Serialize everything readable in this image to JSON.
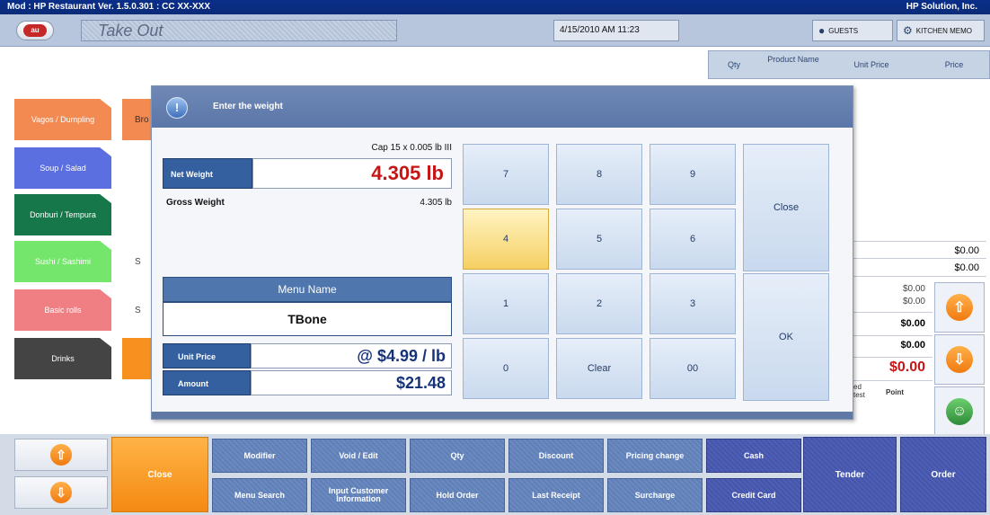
{
  "titlebar": {
    "left": "Mod : HP Restaurant Ver. 1.5.0.301 : CC XX-XXX",
    "right": "HP Solution, Inc."
  },
  "header": {
    "logo": "au",
    "order_type": "Take Out",
    "datetime": "4/15/2010 AM 11:23",
    "guests_label": "GUESTS",
    "kitchen_label": "KITCHEN MEMO"
  },
  "list_header": {
    "qty": "Qty",
    "product": "Product Name",
    "unit_price": "Unit Price",
    "price": "Price"
  },
  "categories": [
    {
      "label": "Vagos / Dumpling",
      "color": "#f28a52",
      "side": "Bro"
    },
    {
      "label": "Soup / Salad",
      "color": "#5b6fe0",
      "side": ""
    },
    {
      "label": "Donburi / Tempura",
      "color": "#16784a",
      "side": ""
    },
    {
      "label": "Sushi / Sashimi",
      "color": "#74e66b",
      "side": "S"
    },
    {
      "label": "Basic rolls",
      "color": "#f07f84",
      "side": "S"
    },
    {
      "label": "Drinks",
      "color": "#444444",
      "side": ""
    }
  ],
  "order_summary": {
    "row1": "$0.00",
    "row2": "$0.00",
    "row3a": "$0.00",
    "row3b": "$0.00",
    "row4": "$0.00",
    "row5": "$0.00",
    "total": "$0.00",
    "label_ed": "ed",
    "label_test": "test",
    "label_point": "Point"
  },
  "dialog": {
    "title": "Enter the weight",
    "cap": "Cap 15 x 0.005 lb III",
    "net_weight_label": "Net Weight",
    "net_weight_value": "4.305 lb",
    "gross_weight_label": "Gross Weight",
    "gross_weight_value": "4.305 lb",
    "menu_name_label": "Menu Name",
    "menu_name_value": "TBone",
    "unit_price_label": "Unit Price",
    "unit_price_value": "@ $4.99 / lb",
    "amount_label": "Amount",
    "amount_value": "$21.48",
    "keys": [
      "7",
      "8",
      "9",
      "4",
      "5",
      "6",
      "1",
      "2",
      "3",
      "0",
      "Clear",
      "00"
    ],
    "close_label": "Close",
    "ok_label": "OK"
  },
  "bottom": {
    "close": "Close",
    "modifier": "Modifier",
    "void_edit": "Void / Edit",
    "qty": "Qty",
    "discount": "Discount",
    "pricing_change": "Pricing change",
    "cash": "Cash",
    "menu_search": "Menu Search",
    "input_customer": "Input Customer Information",
    "hold_order": "Hold Order",
    "last_receipt": "Last Receipt",
    "surcharge": "Surcharge",
    "credit_card": "Credit Card",
    "tender": "Tender",
    "order": "Order"
  }
}
